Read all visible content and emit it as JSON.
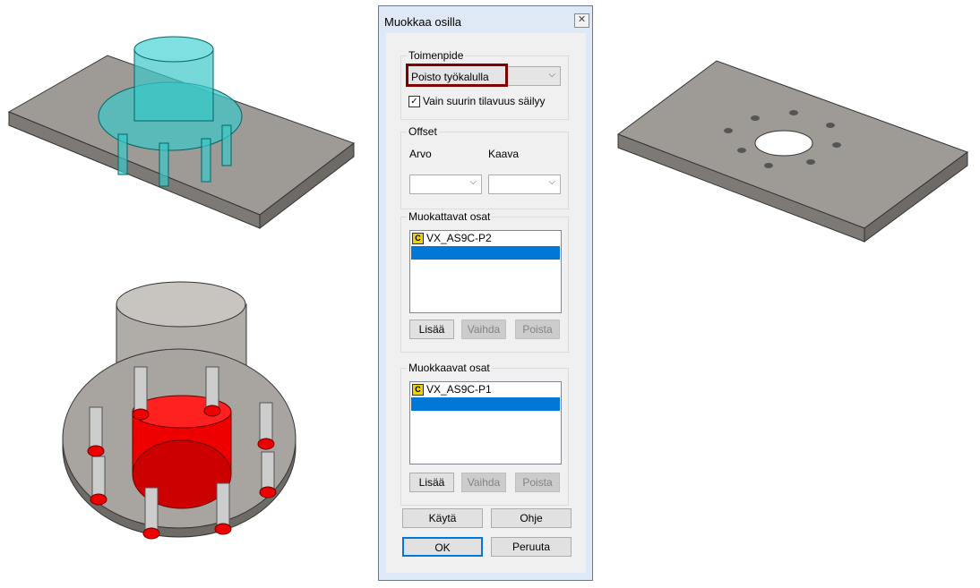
{
  "dialog": {
    "title": "Muokkaa osilla",
    "close_icon": "close-icon",
    "operation": {
      "legend": "Toimenpide",
      "value": "Poisto työkalulla",
      "checkbox_label": "Vain suurin tilavuus säilyy",
      "checked": true
    },
    "offset": {
      "legend": "Offset",
      "arvo_label": "Arvo",
      "kaava_label": "Kaava",
      "arvo_value": "",
      "kaava_value": ""
    },
    "modified_parts": {
      "legend": "Muokattavat osat",
      "items": [
        "VX_AS9C-P2"
      ],
      "add": "Lisää",
      "replace": "Vaihda",
      "remove": "Poista"
    },
    "modifying_parts": {
      "legend": "Muokkaavat osat",
      "items": [
        "VX_AS9C-P1"
      ],
      "add": "Lisää",
      "replace": "Vaihda",
      "remove": "Poista"
    },
    "buttons": {
      "apply": "Käytä",
      "help": "Ohje",
      "ok": "OK",
      "cancel": "Peruuta"
    }
  },
  "colors": {
    "highlight": "#800000",
    "selection": "#0078d7",
    "tool": "#ff0000",
    "transparent_part": "#3cc8c8"
  }
}
